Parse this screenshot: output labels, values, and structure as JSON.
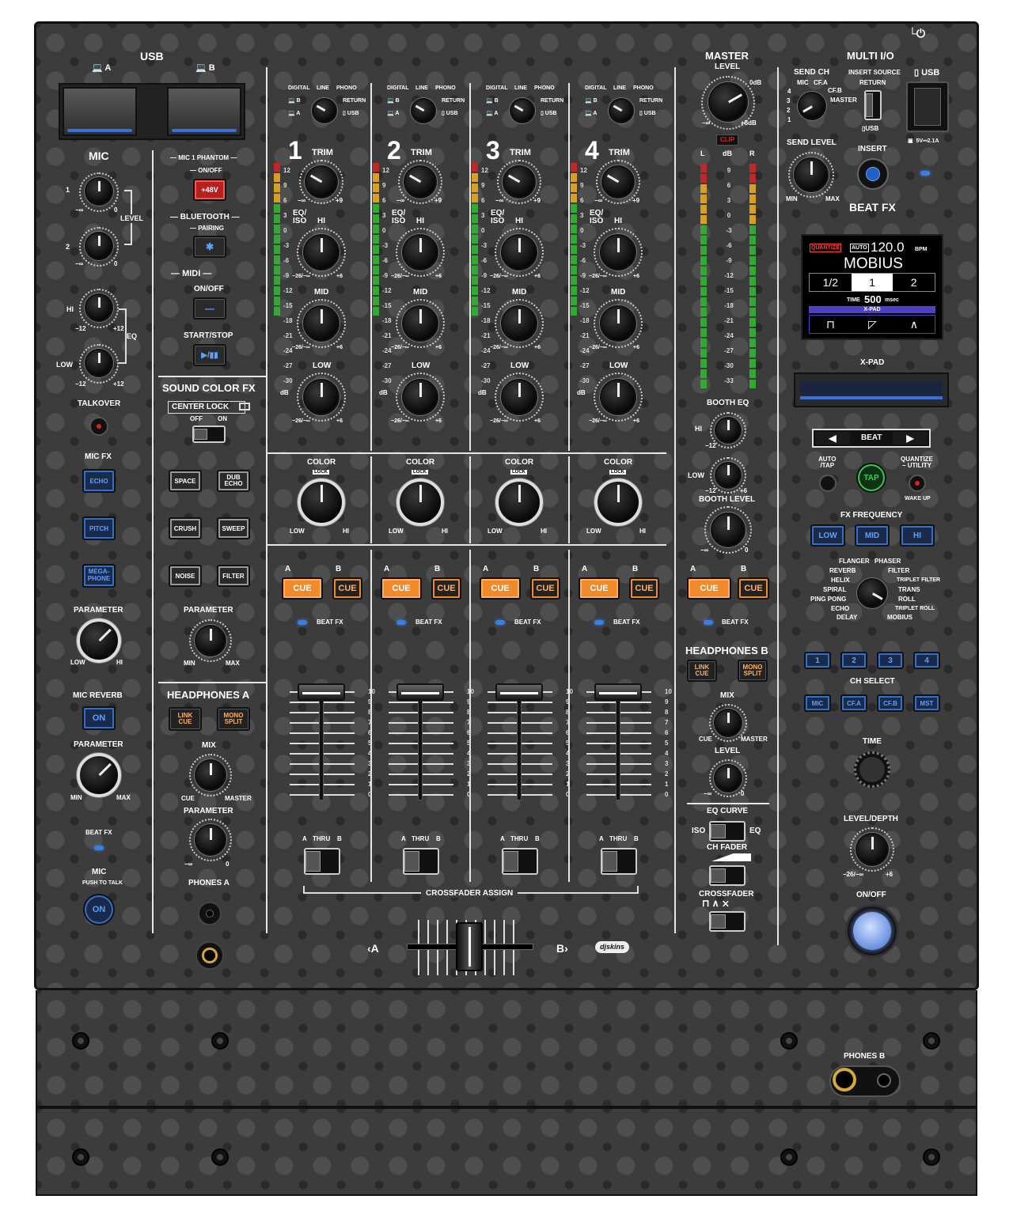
{
  "usb": {
    "title": "USB",
    "a": "A",
    "b": "B"
  },
  "mic": {
    "title": "MIC",
    "ch1": "1",
    "ch2": "2",
    "level": "LEVEL",
    "hi": "HI",
    "low": "LOW",
    "eq": "EQ",
    "min_inf": "−∞",
    "zero": "0",
    "m12": "−12",
    "p12": "+12",
    "talkover": "TALKOVER",
    "mic_fx": "MIC FX",
    "echo": "ECHO",
    "pitch": "PITCH",
    "megaphone": "MEGA-\nPHONE",
    "parameter": "PARAMETER",
    "lo": "LOW",
    "hi2": "HI",
    "mic_reverb": "MIC REVERB",
    "on": "ON",
    "parameter2": "PARAMETER",
    "min": "MIN",
    "max": "MAX",
    "beat_fx": "BEAT FX",
    "mic_bottom": "MIC",
    "push_to_talk": "PUSH TO TALK",
    "on2": "ON"
  },
  "phantom": {
    "title": "MIC 1 PHANTOM",
    "onoff": "ON/OFF",
    "btn": "+48V"
  },
  "bluetooth": {
    "title": "BLUETOOTH",
    "pairing": "PAIRING"
  },
  "midi": {
    "title": "MIDI",
    "onoff": "ON/OFF",
    "startstop": "START/STOP"
  },
  "scfx": {
    "title": "SOUND COLOR FX",
    "center_lock": "CENTER LOCK",
    "off": "OFF",
    "on": "ON",
    "space": "SPACE",
    "dub_echo": "DUB\nECHO",
    "crush": "CRUSH",
    "sweep": "SWEEP",
    "noise": "NOISE",
    "filter": "FILTER",
    "parameter": "PARAMETER",
    "min": "MIN",
    "max": "MAX"
  },
  "hpa": {
    "title": "HEADPHONES A",
    "link_cue": "LINK\nCUE",
    "mono_split": "MONO\nSPLIT",
    "mix": "MIX",
    "cue": "CUE",
    "master": "MASTER",
    "parameter": "PARAMETER",
    "min_inf": "−∞",
    "zero": "0",
    "phones": "PHONES A"
  },
  "channels": [
    {
      "num": "1"
    },
    {
      "num": "2"
    },
    {
      "num": "3"
    },
    {
      "num": "4"
    }
  ],
  "ch_labels": {
    "digital": "DIGITAL",
    "line": "LINE",
    "phono": "PHONO",
    "return": "RETURN",
    "usb": "USB",
    "b": "B",
    "a": "A",
    "trim": "TRIM",
    "trim_min": "−∞",
    "trim_max": "+9",
    "eqiso": "EQ/\nISO",
    "hi": "HI",
    "mid": "MID",
    "low": "LOW",
    "eq_min": "−26/−∞",
    "eq_max": "+6",
    "color": "COLOR",
    "lock": "LOCK",
    "c_low": "LOW",
    "c_hi": "HI",
    "cue_a": "A",
    "cue_b": "B",
    "cue": "CUE",
    "beat_fx": "BEAT FX",
    "thru": "THRU",
    "xa": "A",
    "xb": "B",
    "db": "dB"
  },
  "meter_scale": [
    "12",
    "9",
    "6",
    "3",
    "0",
    "-3",
    "-6",
    "-9",
    "-12",
    "-15",
    "-18",
    "-21",
    "-24",
    "-27",
    "-30"
  ],
  "fader_scale": [
    "10",
    "9",
    "8",
    "7",
    "6",
    "5",
    "4",
    "3",
    "2",
    "1",
    "0"
  ],
  "crossfader": {
    "assign": "CROSSFADER ASSIGN",
    "a": "‹A",
    "b": "B›"
  },
  "master": {
    "title": "MASTER",
    "level": "LEVEL",
    "odb": "0dB",
    "p5": "+5dB",
    "min_inf": "−∞",
    "clip": "CLIP",
    "l": "L",
    "db": "dB",
    "r": "R",
    "scale": [
      "9",
      "6",
      "3",
      "0",
      "-3",
      "-6",
      "-9",
      "-12",
      "-15",
      "-18",
      "-21",
      "-24",
      "-27",
      "-30",
      "-33"
    ]
  },
  "booth": {
    "eq": "BOOTH EQ",
    "hi": "HI",
    "low": "LOW",
    "m12": "−12",
    "p6": "+6",
    "level": "BOOTH LEVEL",
    "min_inf": "−∞",
    "zero": "0"
  },
  "master_cue": {
    "a": "A",
    "b": "B",
    "cue": "CUE",
    "beat_fx": "BEAT FX"
  },
  "hpb": {
    "title": "HEADPHONES B",
    "link_cue": "LINK\nCUE",
    "mono_split": "MONO\nSPLIT",
    "mix": "MIX",
    "cue": "CUE",
    "master": "MASTER",
    "level": "LEVEL",
    "min_inf": "−∞",
    "zero": "0"
  },
  "curves": {
    "eq_curve": "EQ CURVE",
    "iso": "ISO",
    "eq": "EQ",
    "ch_fader": "CH FADER",
    "crossfader": "CROSSFADER"
  },
  "multi_io": {
    "title": "MULTI I/O",
    "send_ch": "SEND CH",
    "mic": "MIC",
    "cfa": "CF.A",
    "cfb": "CF.B",
    "master": "MASTER",
    "n4": "4",
    "n3": "3",
    "n2": "2",
    "n1": "1",
    "insert_source": "INSERT SOURCE",
    "return": "RETURN",
    "usb": "USB",
    "usb_top": "USB",
    "send_level": "SEND LEVEL",
    "min": "MIN",
    "max": "MAX",
    "insert": "INSERT",
    "power": "5V⎓2.1A"
  },
  "beat_fx": {
    "title": "BEAT FX",
    "quantize": "QUANTIZE",
    "auto": "AUTO",
    "bpm": "120.0",
    "bpm_unit": "BPM",
    "effect": "MOBIUS",
    "beats": [
      "1/2",
      "1",
      "2"
    ],
    "time_label": "TIME",
    "time": "500",
    "time_unit": "msec",
    "xpad": "X-PAD",
    "xpad_label": "X-PAD",
    "beat": "BEAT",
    "auto_tap": "AUTO\n/TAP",
    "tap": "TAP",
    "quantize_utility": "QUANTIZE\n− UTILITY",
    "wake_up": "WAKE UP",
    "fx_freq": "FX FREQUENCY",
    "low": "LOW",
    "mid": "MID",
    "hi": "HI",
    "effects_left": [
      "FLANGER",
      "REVERB",
      "HELIX",
      "SPIRAL",
      "PING PONG",
      "ECHO",
      "DELAY"
    ],
    "effects_right": [
      "PHASER",
      "FILTER",
      "TRIPLET FILTER",
      "TRANS",
      "ROLL",
      "TRIPLET ROLL",
      "MOBIUS"
    ],
    "ch": [
      "1",
      "2",
      "3",
      "4"
    ],
    "ch_select": "CH SELECT",
    "sel": [
      "MIC",
      "CF.A",
      "CF.B",
      "MST"
    ],
    "time_knob": "TIME",
    "level_depth": "LEVEL/DEPTH",
    "ld_min": "−26/−∞",
    "ld_max": "+6",
    "onoff": "ON/OFF"
  },
  "phones_b": "PHONES B",
  "brand": "djskins"
}
